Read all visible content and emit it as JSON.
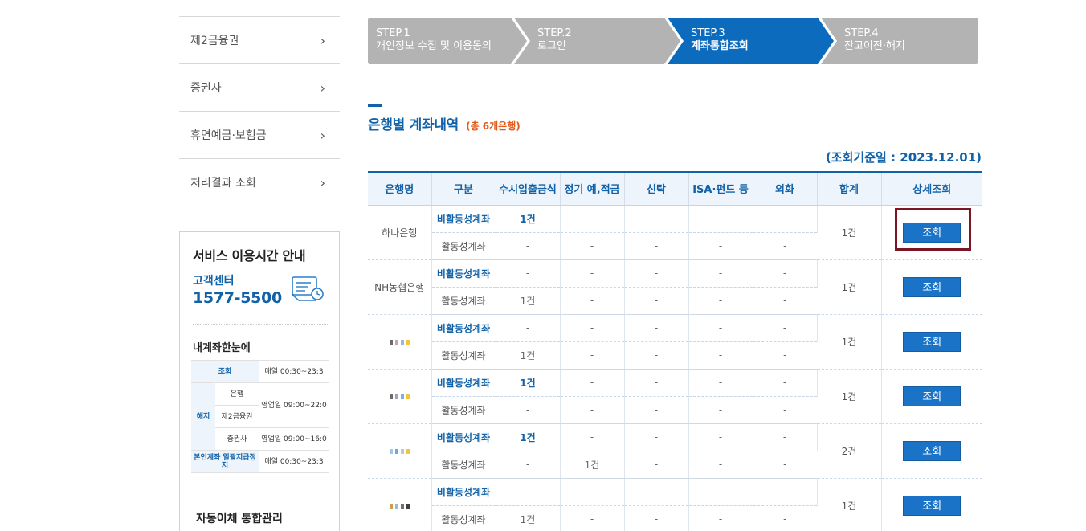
{
  "sidebar": {
    "items": [
      {
        "label": "제2금융권"
      },
      {
        "label": "증권사"
      },
      {
        "label": "휴면예금·보험금"
      },
      {
        "label": "처리결과 조회"
      }
    ],
    "service": {
      "title": "서비스 이용시간 안내",
      "customer_center_label": "고객센터",
      "phone": "1577-5500",
      "my_account_title": "내계좌한눈에",
      "hours": {
        "inquiry_label": "조회",
        "inquiry_time": "매일 00:30~23:3",
        "cancel_label": "해지",
        "bank_label": "은행",
        "bank_time": "영업일 09:00~22:0",
        "second_label": "제2금융권",
        "securities_label": "증권사",
        "securities_time": "영업일 09:00~16:0",
        "self_label": "본인계좌 일괄지급정지",
        "self_time": "매일 00:30~23:3"
      },
      "auto_transfer_title": "자동이체 통합관리"
    }
  },
  "steps": [
    {
      "num": "STEP.1",
      "label": "개인정보 수집 및 이용동의",
      "active": false
    },
    {
      "num": "STEP.2",
      "label": "로그인",
      "active": false
    },
    {
      "num": "STEP.3",
      "label": "계좌통합조회",
      "active": true
    },
    {
      "num": "STEP.4",
      "label": "잔고이전·해지",
      "active": false
    }
  ],
  "colors": {
    "step_inactive": "#b3b3b3",
    "step_active": "#0d6bbd",
    "accent": "#1162a8",
    "highlight": "#7a1523"
  },
  "section": {
    "title": "은행별 계좌내역",
    "total": "(총 6개은행)"
  },
  "ref_date": "(조회기준일 : 2023.12.01)",
  "table": {
    "headers": [
      "은행명",
      "구분",
      "수시입출금식",
      "정기 예,적금",
      "신탁",
      "ISA·펀드 등",
      "외화",
      "합계",
      "상세조회"
    ],
    "button_label": "조회",
    "banks": [
      {
        "name": "하나은행",
        "total": "1건",
        "inactive": {
          "type": "비활동성계좌",
          "cells": [
            "1건",
            "-",
            "-",
            "-",
            "-"
          ]
        },
        "active": {
          "type": "활동성계좌",
          "cells": [
            "-",
            "-",
            "-",
            "-",
            "-"
          ]
        }
      },
      {
        "name": "NH농협은행",
        "total": "1건",
        "inactive": {
          "type": "비활동성계좌",
          "cells": [
            "-",
            "-",
            "-",
            "-",
            "-"
          ]
        },
        "active": {
          "type": "활동성계좌",
          "cells": [
            "1건",
            "-",
            "-",
            "-",
            "-"
          ]
        }
      },
      {
        "name": "",
        "total": "1건",
        "inactive": {
          "type": "비활동성계좌",
          "cells": [
            "-",
            "-",
            "-",
            "-",
            "-"
          ]
        },
        "active": {
          "type": "활동성계좌",
          "cells": [
            "1건",
            "-",
            "-",
            "-",
            "-"
          ]
        }
      },
      {
        "name": "",
        "total": "1건",
        "inactive": {
          "type": "비활동성계좌",
          "cells": [
            "1건",
            "-",
            "-",
            "-",
            "-"
          ]
        },
        "active": {
          "type": "활동성계좌",
          "cells": [
            "-",
            "-",
            "-",
            "-",
            "-"
          ]
        }
      },
      {
        "name": "",
        "total": "2건",
        "inactive": {
          "type": "비활동성계좌",
          "cells": [
            "1건",
            "-",
            "-",
            "-",
            "-"
          ]
        },
        "active": {
          "type": "활동성계좌",
          "cells": [
            "-",
            "1건",
            "-",
            "-",
            "-"
          ]
        }
      },
      {
        "name": "",
        "total": "1건",
        "inactive": {
          "type": "비활동성계좌",
          "cells": [
            "-",
            "-",
            "-",
            "-",
            "-"
          ]
        },
        "active": {
          "type": "활동성계좌",
          "cells": [
            "1건",
            "-",
            "-",
            "-",
            "-"
          ]
        }
      }
    ]
  }
}
